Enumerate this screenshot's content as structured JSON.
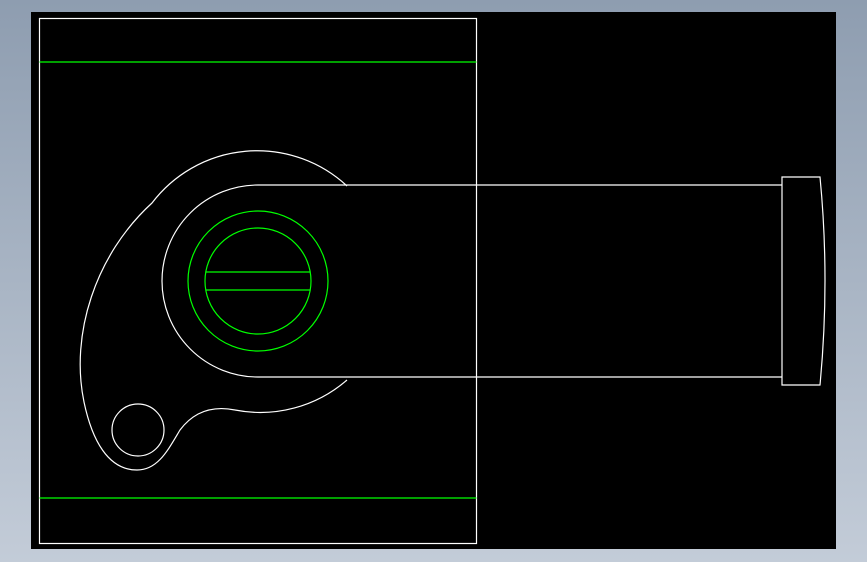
{
  "colors": {
    "background_gradient_top": "#8e9db0",
    "background_gradient_bottom": "#c3ccd8",
    "viewport": "#000000",
    "outline": "#ffffff",
    "construction": "#00ff00"
  },
  "drawing_type": "cad-2d-view"
}
